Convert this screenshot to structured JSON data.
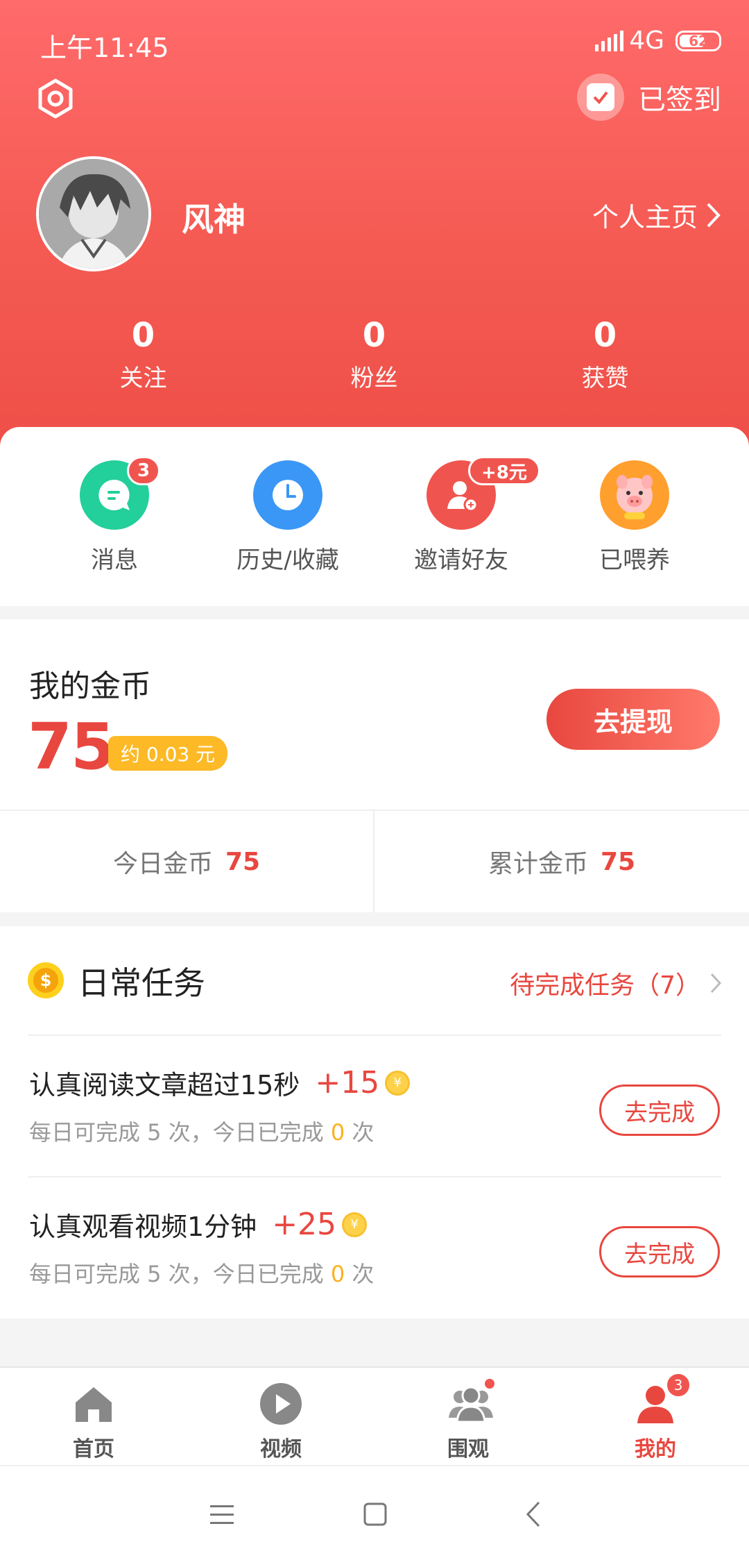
{
  "status_bar": {
    "time": "上午11:45",
    "network": "4G",
    "battery": "62"
  },
  "header": {
    "checkin_label": "已签到",
    "username": "风神",
    "profile_link": "个人主页",
    "stats": [
      {
        "value": "0",
        "label": "关注"
      },
      {
        "value": "0",
        "label": "粉丝"
      },
      {
        "value": "0",
        "label": "获赞"
      }
    ]
  },
  "quick_actions": [
    {
      "label": "消息",
      "icon": "message-icon",
      "badge": "3",
      "color": "#23cf9b"
    },
    {
      "label": "历史/收藏",
      "icon": "clock-icon",
      "color": "#3b97f5"
    },
    {
      "label": "邀请好友",
      "icon": "add-user-icon",
      "badge": "+8元",
      "color": "#f0544e"
    },
    {
      "label": "已喂养",
      "icon": "pig-icon",
      "color": "#ff9f2e"
    }
  ],
  "coins": {
    "title": "我的金币",
    "amount": "75",
    "approx": "约 0.03 元",
    "withdraw_label": "去提现",
    "today_label": "今日金币",
    "today_value": "75",
    "total_label": "累计金币",
    "total_value": "75"
  },
  "tasks": {
    "coin_glyph": "$",
    "title": "日常任务",
    "pending_label": "待完成任务（7）",
    "items": [
      {
        "name": "认真阅读文章超过15秒",
        "reward": "+15",
        "sub_prefix": "每日可完成 5 次，今日已完成",
        "done": "0",
        "sub_suffix": "次",
        "button": "去完成"
      },
      {
        "name": "认真观看视频1分钟",
        "reward": "+25",
        "sub_prefix": "每日可完成 5 次，今日已完成",
        "done": "0",
        "sub_suffix": "次",
        "button": "去完成"
      }
    ]
  },
  "tabbar": {
    "items": [
      {
        "label": "首页",
        "icon": "home-icon"
      },
      {
        "label": "视频",
        "icon": "play-icon"
      },
      {
        "label": "围观",
        "icon": "group-icon"
      },
      {
        "label": "我的",
        "icon": "user-icon",
        "badge": "3"
      }
    ]
  },
  "colors": {
    "accent": "#e8473f",
    "header": "#f45a52",
    "gold": "#fdb926"
  }
}
